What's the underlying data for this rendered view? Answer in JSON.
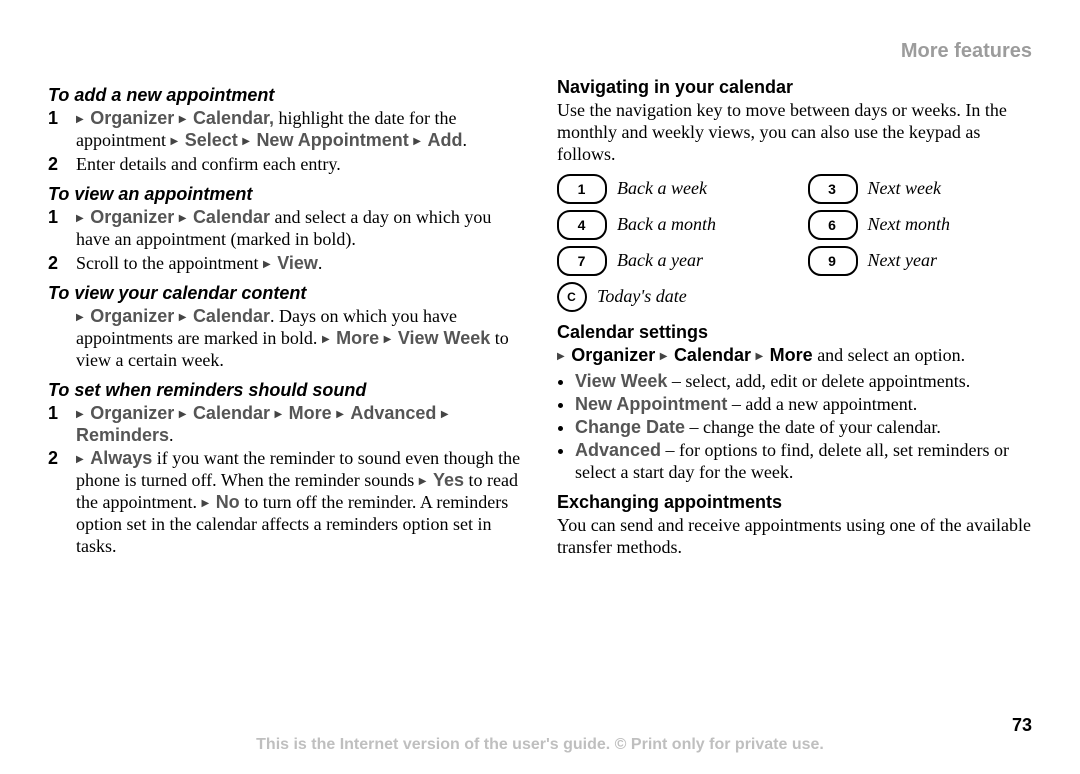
{
  "runningHead": "More features",
  "pageNumber": "73",
  "disclaimer": "This is the Internet version of the user's guide. © Print only for private use.",
  "left": {
    "s1": {
      "title": "To add a new appointment",
      "step1_pre": "",
      "step1_a": "Organizer",
      "step1_b": "Calendar,",
      "step1_mid": " highlight the date for the appointment ",
      "step1_c": "Select",
      "step1_d": "New Appointment",
      "step1_e": "Add",
      "step1_end": ".",
      "step2": "Enter details and confirm each entry."
    },
    "s2": {
      "title": "To view an appointment",
      "step1_a": "Organizer",
      "step1_b": "Calendar",
      "step1_mid": " and select a day on which you have an appointment (marked in bold).",
      "step2_pre": "Scroll to the appointment ",
      "step2_a": "View",
      "step2_end": "."
    },
    "s3": {
      "title": "To view your calendar content",
      "p_a": "Organizer",
      "p_b": "Calendar",
      "p_mid1": ". Days on which you have appointments are marked in bold. ",
      "p_c": "More",
      "p_d": "View Week",
      "p_end": " to view a certain week."
    },
    "s4": {
      "title": "To set when reminders should sound",
      "step1_a": "Organizer",
      "step1_b": "Calendar",
      "step1_c": "More",
      "step1_d": "Advanced",
      "step1_e": "Reminders",
      "step1_end": ".",
      "step2_a": "Always",
      "step2_mid1": " if you want the reminder to sound even though the phone is turned off. When the reminder sounds ",
      "step2_b": "Yes",
      "step2_mid2": " to read the appointment. ",
      "step2_c": "No",
      "step2_mid3": " to turn off the reminder. A reminders option set in the calendar affects a reminders option set in tasks."
    }
  },
  "right": {
    "nav": {
      "title": "Navigating in your calendar",
      "para": "Use the navigation key to move between days or weeks. In the monthly and weekly views, you can also use the keypad as follows.",
      "keys": [
        {
          "cap": "1",
          "label": "Back a week"
        },
        {
          "cap": "3",
          "label": "Next week"
        },
        {
          "cap": "4",
          "label": "Back a month"
        },
        {
          "cap": "6",
          "label": "Next month"
        },
        {
          "cap": "7",
          "label": "Back a year"
        },
        {
          "cap": "9",
          "label": "Next year"
        },
        {
          "cap": "C",
          "label": "Today's date",
          "small": true
        }
      ]
    },
    "settings": {
      "title": "Calendar settings",
      "lead_a": "Organizer",
      "lead_b": "Calendar",
      "lead_c": "More",
      "lead_end": " and select an option.",
      "items": [
        {
          "term": "View Week",
          "rest": " – select, add, edit or delete appointments."
        },
        {
          "term": "New Appointment",
          "rest": " – add a new appointment."
        },
        {
          "term": "Change Date",
          "rest": " – change the date of your calendar."
        },
        {
          "term": "Advanced",
          "rest": " – for options to find, delete all, set reminders or select a start day for the week."
        }
      ]
    },
    "exchange": {
      "title": "Exchanging appointments",
      "para": "You can send and receive appointments using one of the available transfer methods."
    }
  }
}
